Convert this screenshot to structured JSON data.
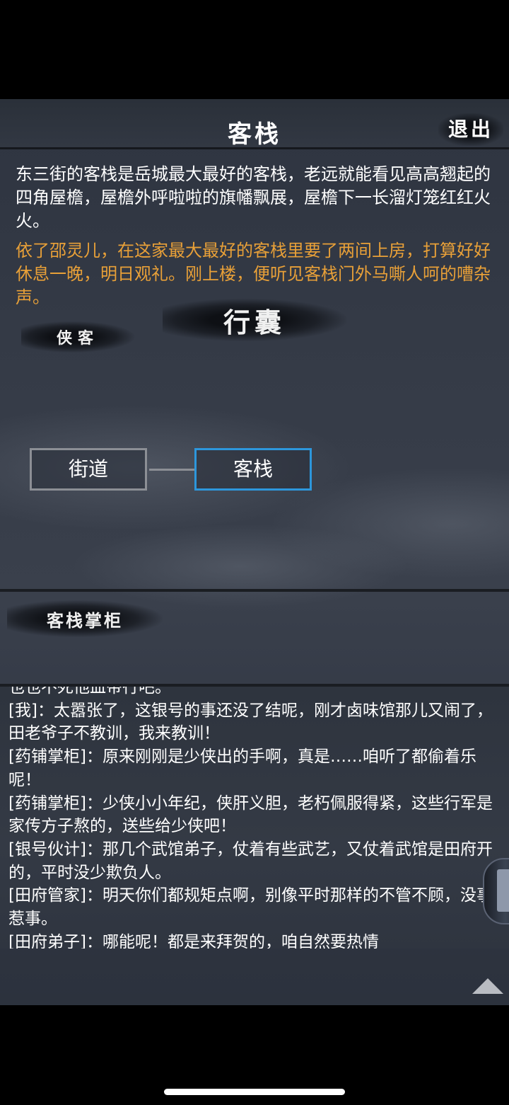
{
  "header": {
    "title": "客栈",
    "exit_label": "退出"
  },
  "description": {
    "scene": "东三街的客栈是岳城最大最好的客栈，老远就能看见高高翘起的四角屋檐，屋檐外呼啦啦的旗幡飘展，屋檐下一长溜灯笼红红火火。",
    "event": "依了邵灵儿，在这家最大最好的客栈里要了两间上房，打算好好休息一晚，明日观礼。刚上楼，便听见客栈门外马嘶人呵的嘈杂声。"
  },
  "labels": {
    "bag": "行囊",
    "hero": "侠客",
    "npc": "客栈掌柜"
  },
  "map": {
    "nodes": [
      {
        "label": "街道",
        "current": false
      },
      {
        "label": "客栈",
        "current": true
      }
    ]
  },
  "log": {
    "lines": [
      "也也不死他血带行吧。",
      "[我]：太嚣张了，这银号的事还没了结呢，刚才卤味馆那儿又闹了，田老爷子不教训，我来教训！",
      "[药铺掌柜]：原来刚刚是少侠出的手啊，真是……咱听了都偷着乐呢！",
      "[药铺掌柜]：少侠小小年纪，侠肝义胆，老朽佩服得紧，这些行军是家传方子熬的，送些给少侠吧！",
      "[银号伙计]：那几个武馆弟子，仗着有些武艺，又仗着武馆是田府开的，平时没少欺负人。",
      "[田府管家]：明天你们都规矩点啊，别像平时那样的不管不顾，没事惹事。",
      "[田府弟子]：哪能呢！都是来拜贺的，咱自然要热情"
    ]
  },
  "colors": {
    "event_text": "#e8a038",
    "current_node_border": "#2d97dc",
    "node_border": "#8c8f95"
  }
}
